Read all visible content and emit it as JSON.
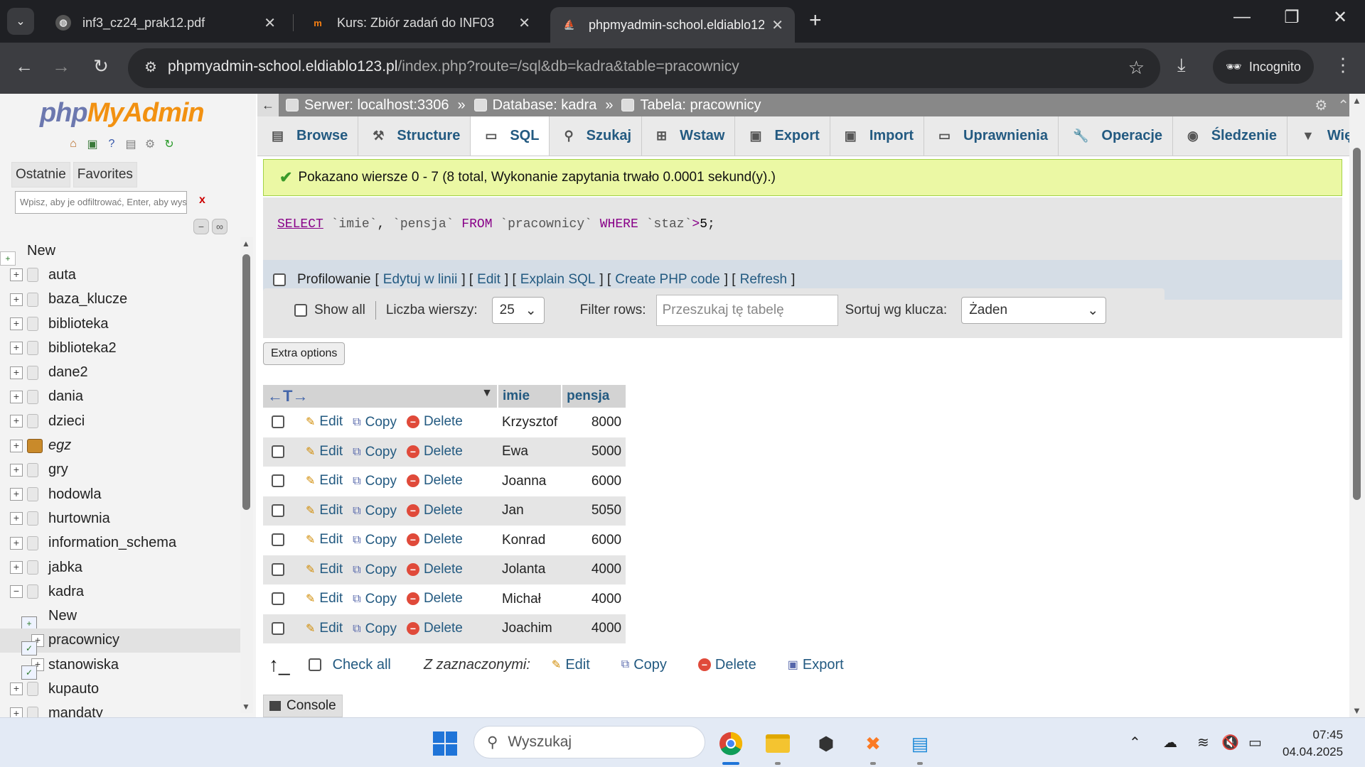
{
  "browser": {
    "tabs": [
      {
        "title": "inf3_cz24_prak12.pdf",
        "icon": "globe-icon"
      },
      {
        "title": "Kurs: Zbiór zadań do INF03",
        "icon": "moodle-icon"
      },
      {
        "title": "phpmyadmin-school.eldiablo12",
        "icon": "phpmyadmin-icon"
      }
    ],
    "url_host": "phpmyadmin-school.eldiablo123.pl",
    "url_path": "/index.php?route=/sql&db=kadra&table=pracownicy",
    "incognito_label": "Incognito"
  },
  "nav": {
    "logo_php": "php",
    "logo_myadmin": "MyAdmin",
    "tabs": [
      "Ostatnie",
      "Favorites"
    ],
    "filter_placeholder": "Wpisz, aby je odfiltrować, Enter, aby wyszukać wszystkie",
    "filter_clear": "x",
    "tree": {
      "new": "New",
      "auta": "auta",
      "baza_klucze": "baza_klucze",
      "biblioteka": "biblioteka",
      "biblioteka2": "biblioteka2",
      "dane2": "dane2",
      "dania": "dania",
      "dzieci": "dzieci",
      "egz": "egz",
      "gry": "gry",
      "hodowla": "hodowla",
      "hurtownia": "hurtownia",
      "information_schema": "information_schema",
      "jabka": "jabka",
      "kadra": "kadra",
      "kadra_new": "New",
      "pracownicy": "pracownicy",
      "stanowiska": "stanowiska",
      "kupauto": "kupauto",
      "mandaty": "mandaty"
    }
  },
  "breadcrumb": {
    "server": "Serwer: localhost:3306",
    "database": "Database: kadra",
    "table": "Tabela: pracownicy",
    "sep": "»"
  },
  "menu": [
    "Browse",
    "Structure",
    "SQL",
    "Szukaj",
    "Wstaw",
    "Export",
    "Import",
    "Uprawnienia",
    "Operacje",
    "Śledzenie",
    "Wię"
  ],
  "success_message": "Pokazano wiersze 0 - 7 (8 total, Wykonanie zapytania trwało 0.0001 sekund(y).)",
  "sql": {
    "select": "SELECT",
    "col1": "`imie`",
    "comma": ",",
    "col2": "`pensja`",
    "from": "FROM",
    "table": "`pracownicy`",
    "where": "WHERE",
    "col3": "`staz`",
    "op": ">",
    "num": "5",
    "end": ";"
  },
  "profiling": {
    "label": "Profilowanie",
    "links": [
      "Edytuj w linii",
      "Edit",
      "Explain SQL",
      "Create PHP code",
      "Refresh"
    ]
  },
  "navbar": {
    "show_all": "Show all",
    "rows_label": "Liczba wierszy:",
    "rows_value": "25",
    "filter_label": "Filter rows:",
    "filter_placeholder": "Przeszukaj tę tabelę",
    "sort_label": "Sortuj wg klucza:",
    "sort_value": "Żaden"
  },
  "extra_options": "Extra options",
  "table": {
    "arrows": "←T→",
    "headers": [
      "imie",
      "pensja"
    ],
    "action_edit": "Edit",
    "action_copy": "Copy",
    "action_delete": "Delete",
    "rows": [
      {
        "imie": "Krzysztof",
        "pensja": "8000"
      },
      {
        "imie": "Ewa",
        "pensja": "5000"
      },
      {
        "imie": "Joanna",
        "pensja": "6000"
      },
      {
        "imie": "Jan",
        "pensja": "5050"
      },
      {
        "imie": "Konrad",
        "pensja": "6000"
      },
      {
        "imie": "Jolanta",
        "pensja": "4000"
      },
      {
        "imie": "Michał",
        "pensja": "4000"
      },
      {
        "imie": "Joachim",
        "pensja": "4000"
      }
    ]
  },
  "bulk": {
    "check_all": "Check all",
    "with_selected": "Z zaznaczonymi:",
    "edit": "Edit",
    "copy": "Copy",
    "delete": "Delete",
    "export": "Export"
  },
  "console": "Console",
  "taskbar": {
    "search": "Wyszukaj",
    "time": "07:45",
    "date": "04.04.2025"
  }
}
